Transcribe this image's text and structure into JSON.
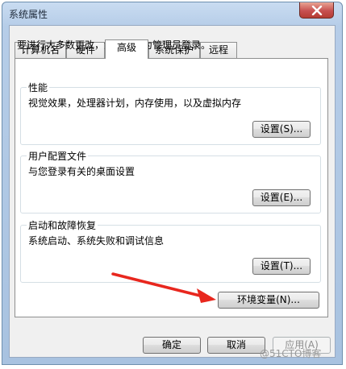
{
  "window": {
    "title": "系统属性"
  },
  "tabs": [
    {
      "label": "计算机名"
    },
    {
      "label": "硬件"
    },
    {
      "label": "高级"
    },
    {
      "label": "系统保护"
    },
    {
      "label": "远程"
    }
  ],
  "advanced": {
    "admin_note": "要进行大多数更改，您必须作为管理员登录。",
    "performance": {
      "label": "性能",
      "desc": "视觉效果，处理器计划，内存使用，以及虚拟内存",
      "button": "设置(S)..."
    },
    "user_profiles": {
      "label": "用户配置文件",
      "desc": "与您登录有关的桌面设置",
      "button": "设置(E)..."
    },
    "startup_recovery": {
      "label": "启动和故障恢复",
      "desc": "系统启动、系统失败和调试信息",
      "button": "设置(T)..."
    },
    "env_button": "环境变量(N)..."
  },
  "footer": {
    "ok": "确定",
    "cancel": "取消",
    "apply": "应用(A)"
  },
  "watermark": "@51CTO博客",
  "colors": {
    "annotation_arrow": "#e8271e",
    "close_button": "#c75050"
  }
}
